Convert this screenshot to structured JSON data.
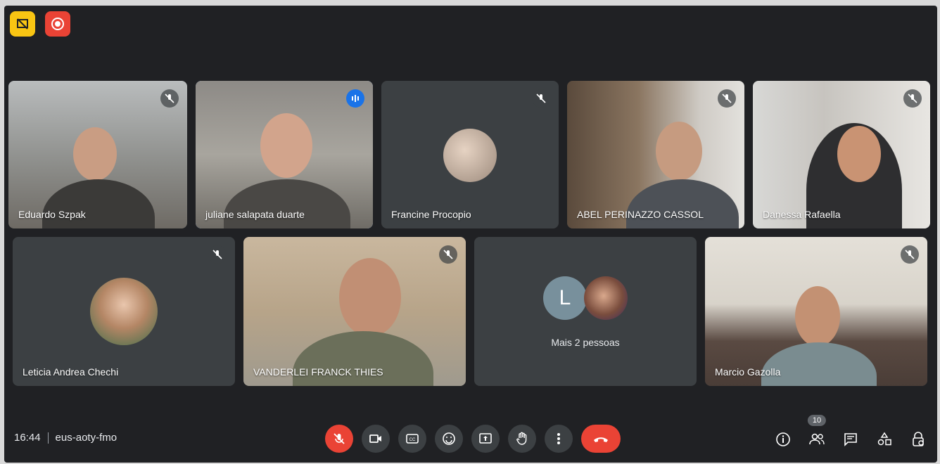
{
  "meeting": {
    "time": "16:44",
    "code": "eus-aoty-fmo"
  },
  "participants_row1": [
    {
      "name": "Eduardo Szpak",
      "muted": true
    },
    {
      "name": "juliane salapata duarte",
      "speaking": true
    },
    {
      "name": "Francine Procopio",
      "muted": true
    },
    {
      "name": "ABEL PERINAZZO CASSOL",
      "muted": true
    },
    {
      "name": "Danessa Rafaella",
      "muted": true
    }
  ],
  "participants_row2": [
    {
      "name": "Leticia Andrea Chechi",
      "muted": true
    },
    {
      "name": "VANDERLEI FRANCK THIES",
      "muted": true
    },
    {
      "name": "Mais 2 pessoas",
      "initial": "L"
    },
    {
      "name": "Marcio Gazolla",
      "muted": true
    }
  ],
  "people_count": "10",
  "colors": {
    "background": "#202124",
    "tile": "#3c4043",
    "accent_red": "#ea4335",
    "accent_yellow": "#f9c513",
    "speaking_blue": "#1a73e8"
  },
  "icons": {
    "top_left": [
      "hide-tiles-icon",
      "record-icon"
    ],
    "controls": [
      "mic-off-icon",
      "camera-icon",
      "captions-icon",
      "emoji-icon",
      "present-icon",
      "raise-hand-icon",
      "more-icon",
      "hang-up-icon"
    ],
    "right": [
      "info-icon",
      "people-icon",
      "chat-icon",
      "activities-icon",
      "host-controls-icon"
    ]
  }
}
